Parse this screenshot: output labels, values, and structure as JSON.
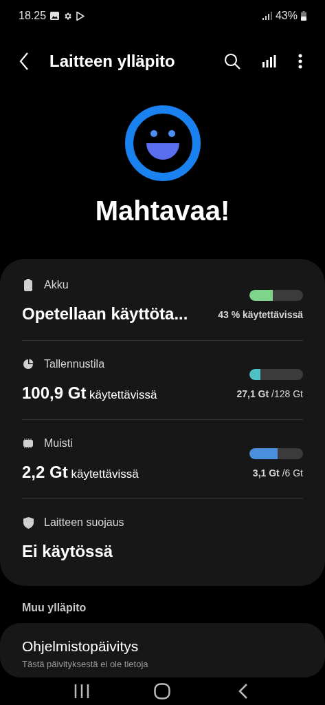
{
  "status_bar": {
    "time": "18.25",
    "battery_percent": "43%"
  },
  "header": {
    "title": "Laitteen ylläpito"
  },
  "status": {
    "headline": "Mahtavaa!"
  },
  "items": [
    {
      "kind": "meter",
      "label": "Akku",
      "value": "Opetellaan käyttöta...",
      "reading": "**43 % käytettävissä**",
      "level": 0.43,
      "color": "#7ed48a"
    },
    {
      "kind": "meter",
      "label": "Tallennustila",
      "value": "**100,9 Gt** käytettävissä",
      "reading": "**27,1 Gt** /128 Gt",
      "level": 0.21,
      "color": "#4fc1c6"
    },
    {
      "kind": "meter",
      "label": "Muisti",
      "value": "**2,2 Gt** käytettävissä",
      "reading": "**3,1 Gt** /6 Gt",
      "level": 0.52,
      "color": "#4a8fdc"
    },
    {
      "kind": "plain",
      "label": "Laitteen suojaus",
      "value": "Ei käytössä"
    }
  ],
  "other": {
    "heading": "Muu ylläpito",
    "title": "Ohjelmistopäivitys",
    "subtitle": "Tästä päivityksestä ei ole tietoja"
  }
}
